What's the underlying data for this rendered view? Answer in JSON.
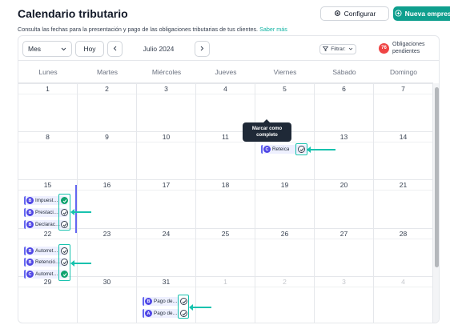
{
  "header": {
    "title": "Calendario tributario",
    "config_label": "Configurar",
    "new_company_label": "Nueva empresa",
    "subtitle": "Consulta las fechas para la presentación y pago de las obligaciones tributarias de tus clientes.",
    "learn_more": "Saber más"
  },
  "toolbar": {
    "view_select": "Mes",
    "today_label": "Hoy",
    "month_label": "Julio 2024",
    "filter_label": "Filtrar:",
    "pending_count": "76",
    "pending_label": "Obligaciones pendientes"
  },
  "weekdays": [
    "Lunes",
    "Martes",
    "Miércoles",
    "Jueves",
    "Viernes",
    "Sábado",
    "Domingo"
  ],
  "weeks": [
    [
      "1",
      "2",
      "3",
      "4",
      "5",
      "6",
      "7"
    ],
    [
      "8",
      "9",
      "10",
      "11",
      "12",
      "13",
      "14"
    ],
    [
      "15",
      "16",
      "17",
      "18",
      "19",
      "20",
      "21"
    ],
    [
      "22",
      "23",
      "24",
      "25",
      "26",
      "27",
      "28"
    ],
    [
      "29",
      "30",
      "31",
      "1",
      "2",
      "3",
      "4"
    ]
  ],
  "events": {
    "day12": [
      {
        "avatar": "C",
        "label": "Reteica",
        "status": "open"
      }
    ],
    "day15": [
      {
        "avatar": "B",
        "label": "Impuest…",
        "status": "done"
      },
      {
        "avatar": "B",
        "label": "Prestaci…",
        "status": "open"
      },
      {
        "avatar": "B",
        "label": "Declarac…",
        "status": "open"
      }
    ],
    "day22": [
      {
        "avatar": "B",
        "label": "Autorret…",
        "status": "open"
      },
      {
        "avatar": "B",
        "label": "Retenció…",
        "status": "open"
      },
      {
        "avatar": "C",
        "label": "Autorret…",
        "status": "done"
      }
    ],
    "day31": [
      {
        "avatar": "B",
        "label": "Pago de…",
        "status": "open"
      },
      {
        "avatar": "A",
        "label": "Pago de…",
        "status": "open"
      }
    ]
  },
  "tooltip": "Marcar como completo",
  "colors": {
    "accent": "#0f9f8e",
    "highlight": "#17c2ae",
    "event_bg": "#eef0ff",
    "avatar": "#4f46e5",
    "done": "#10a36f",
    "badge": "#ef4444"
  }
}
